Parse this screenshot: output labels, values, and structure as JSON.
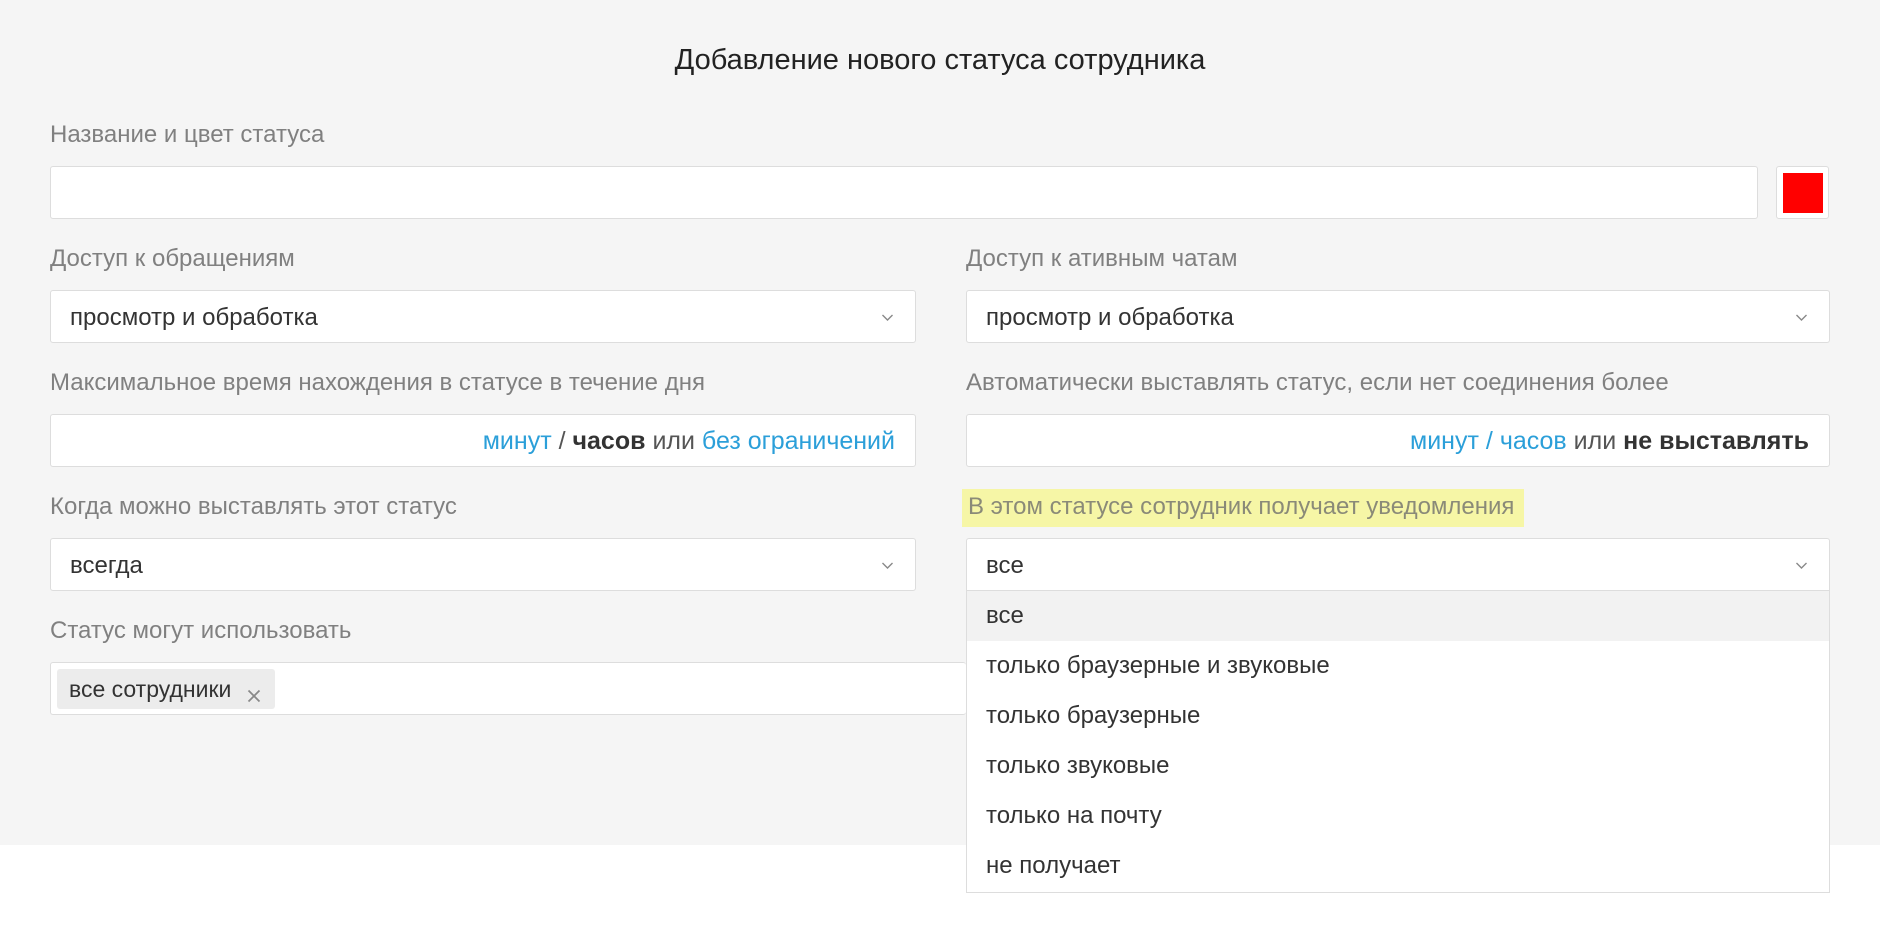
{
  "form": {
    "title": "Добавление нового статуса сотрудника",
    "name_label": "Название и цвет статуса",
    "name_value": "",
    "status_color": "#ff0000",
    "requests_label": "Доступ к обращениям",
    "requests_value": "просмотр и обработка",
    "chats_label": "Доступ к ативным чатам",
    "chats_value": "просмотр и обработка",
    "max_time_label": "Максимальное время нахождения в статусе в течение дня",
    "max_time_units": {
      "minutes": "минут",
      "slash": "/",
      "hours": "часов",
      "or": "или",
      "unlimited": "без ограничений"
    },
    "auto_label": "Автоматически выставлять статус, если нет соединения более",
    "auto_units": {
      "minutes": "минут",
      "slash": "/",
      "hours": "часов",
      "or": "или",
      "never": "не выставлять"
    },
    "when_label": "Когда можно выставлять этот статус",
    "when_value": "всегда",
    "notify_label": "В этом статусе сотрудник получает уведомления",
    "notify_value": "все",
    "notify_options": [
      "все",
      "только браузерные и звуковые",
      "только браузерные",
      "только звуковые",
      "только на почту",
      "не получает"
    ],
    "users_label": "Статус могут использовать",
    "users_tag": "все сотрудники"
  },
  "icons": {
    "chevron": "chevron-down-icon",
    "close": "close-icon"
  },
  "colors": {
    "link": "#2b9fd9",
    "highlight": "#f6f6a6",
    "panel_bg": "#f5f5f5"
  }
}
